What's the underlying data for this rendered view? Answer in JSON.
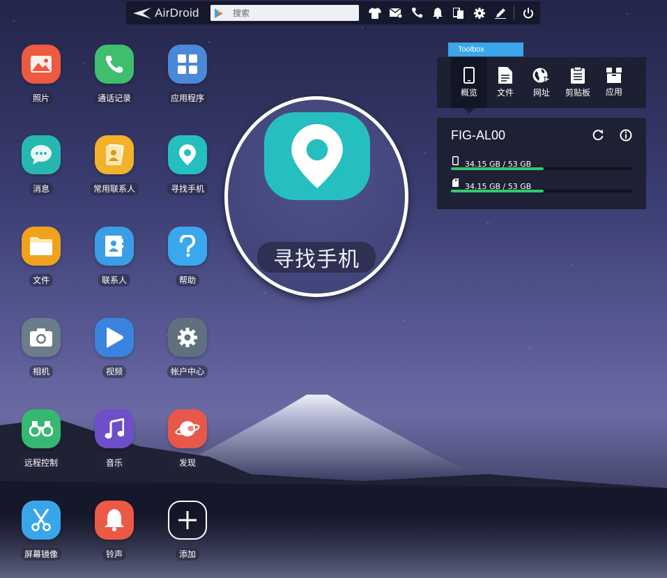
{
  "topbar": {
    "brand": "AirDroid",
    "search_placeholder": "搜索",
    "icons": [
      "tshirt-icon",
      "mail-icon",
      "phone-icon",
      "bell-icon",
      "devices-icon",
      "gear-icon",
      "edit-icon",
      "power-icon"
    ]
  },
  "apps": [
    {
      "label": "照片",
      "color": "#ec5a40",
      "icon": "photo-icon"
    },
    {
      "label": "通话记录",
      "color": "#3fbf6e",
      "icon": "phone-icon"
    },
    {
      "label": "应用程序",
      "color": "#4a88d8",
      "icon": "grid-icon"
    },
    {
      "label": "消息",
      "color": "#26b8b0",
      "icon": "chat-icon"
    },
    {
      "label": "常用联系人",
      "color": "#f2b22a",
      "icon": "contact-card-icon"
    },
    {
      "label": "寻找手机",
      "color": "#26bfc0",
      "icon": "location-pin-icon"
    },
    {
      "label": "文件",
      "color": "#f0a21e",
      "icon": "folder-icon"
    },
    {
      "label": "联系人",
      "color": "#3a9ee6",
      "icon": "address-book-icon"
    },
    {
      "label": "帮助",
      "color": "#3aa8ec",
      "icon": "help-icon"
    },
    {
      "label": "相机",
      "color": "#6b7c8a",
      "icon": "camera-icon"
    },
    {
      "label": "视频",
      "color": "#3a84e0",
      "icon": "play-icon"
    },
    {
      "label": "帐户中心",
      "color": "#60707e",
      "icon": "gear-icon"
    },
    {
      "label": "远程控制",
      "color": "#36b873",
      "icon": "binoculars-icon"
    },
    {
      "label": "音乐",
      "color": "#6e4fc9",
      "icon": "music-icon"
    },
    {
      "label": "发现",
      "color": "#e8584a",
      "icon": "planet-icon"
    },
    {
      "label": "屏幕镜像",
      "color": "#3aa6ea",
      "icon": "scissors-icon"
    },
    {
      "label": "铃声",
      "color": "#ea5a44",
      "icon": "bell-icon"
    },
    {
      "label": "添加",
      "color": "transparent",
      "icon": "plus-icon"
    }
  ],
  "magnifier": {
    "label": "寻找手机"
  },
  "toolbox": {
    "tab": "Toolbox",
    "tools": [
      {
        "label": "概览",
        "icon": "phone-icon",
        "active": true
      },
      {
        "label": "文件",
        "icon": "document-icon"
      },
      {
        "label": "网址",
        "icon": "globe-icon"
      },
      {
        "label": "剪贴板",
        "icon": "clipboard-icon"
      },
      {
        "label": "应用",
        "icon": "box-icon"
      }
    ]
  },
  "device": {
    "name": "FIG-AL00",
    "storage": [
      {
        "icon": "phone-storage-icon",
        "text": "34.15 GB / 53 GB",
        "fraction": 0.51
      },
      {
        "icon": "sd-card-icon",
        "text": "34.15 GB / 53 GB",
        "fraction": 0.51
      }
    ]
  }
}
